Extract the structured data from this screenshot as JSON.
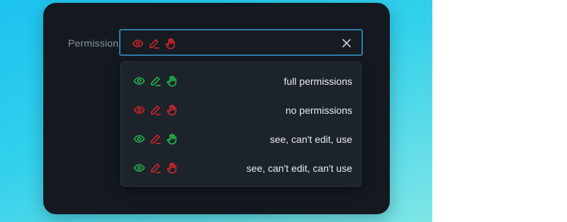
{
  "form": {
    "label": "Permission"
  },
  "colors": {
    "allowed": "#22c24a",
    "denied": "#e0262b",
    "focus_border": "#2c7ea6"
  },
  "select": {
    "current": [
      "denied",
      "denied",
      "denied"
    ],
    "clear_icon": "close-icon"
  },
  "options": [
    {
      "label": "full permissions",
      "see": "allowed",
      "edit": "allowed",
      "use": "allowed"
    },
    {
      "label": "no permissions",
      "see": "denied",
      "edit": "denied",
      "use": "denied"
    },
    {
      "label": "see, can't edit, use",
      "see": "allowed",
      "edit": "denied",
      "use": "allowed"
    },
    {
      "label": "see, can't edit, can't use",
      "see": "allowed",
      "edit": "denied",
      "use": "denied"
    }
  ],
  "icons": {
    "see": "eye-icon",
    "edit": "pencil-icon",
    "use": "hand-icon"
  }
}
